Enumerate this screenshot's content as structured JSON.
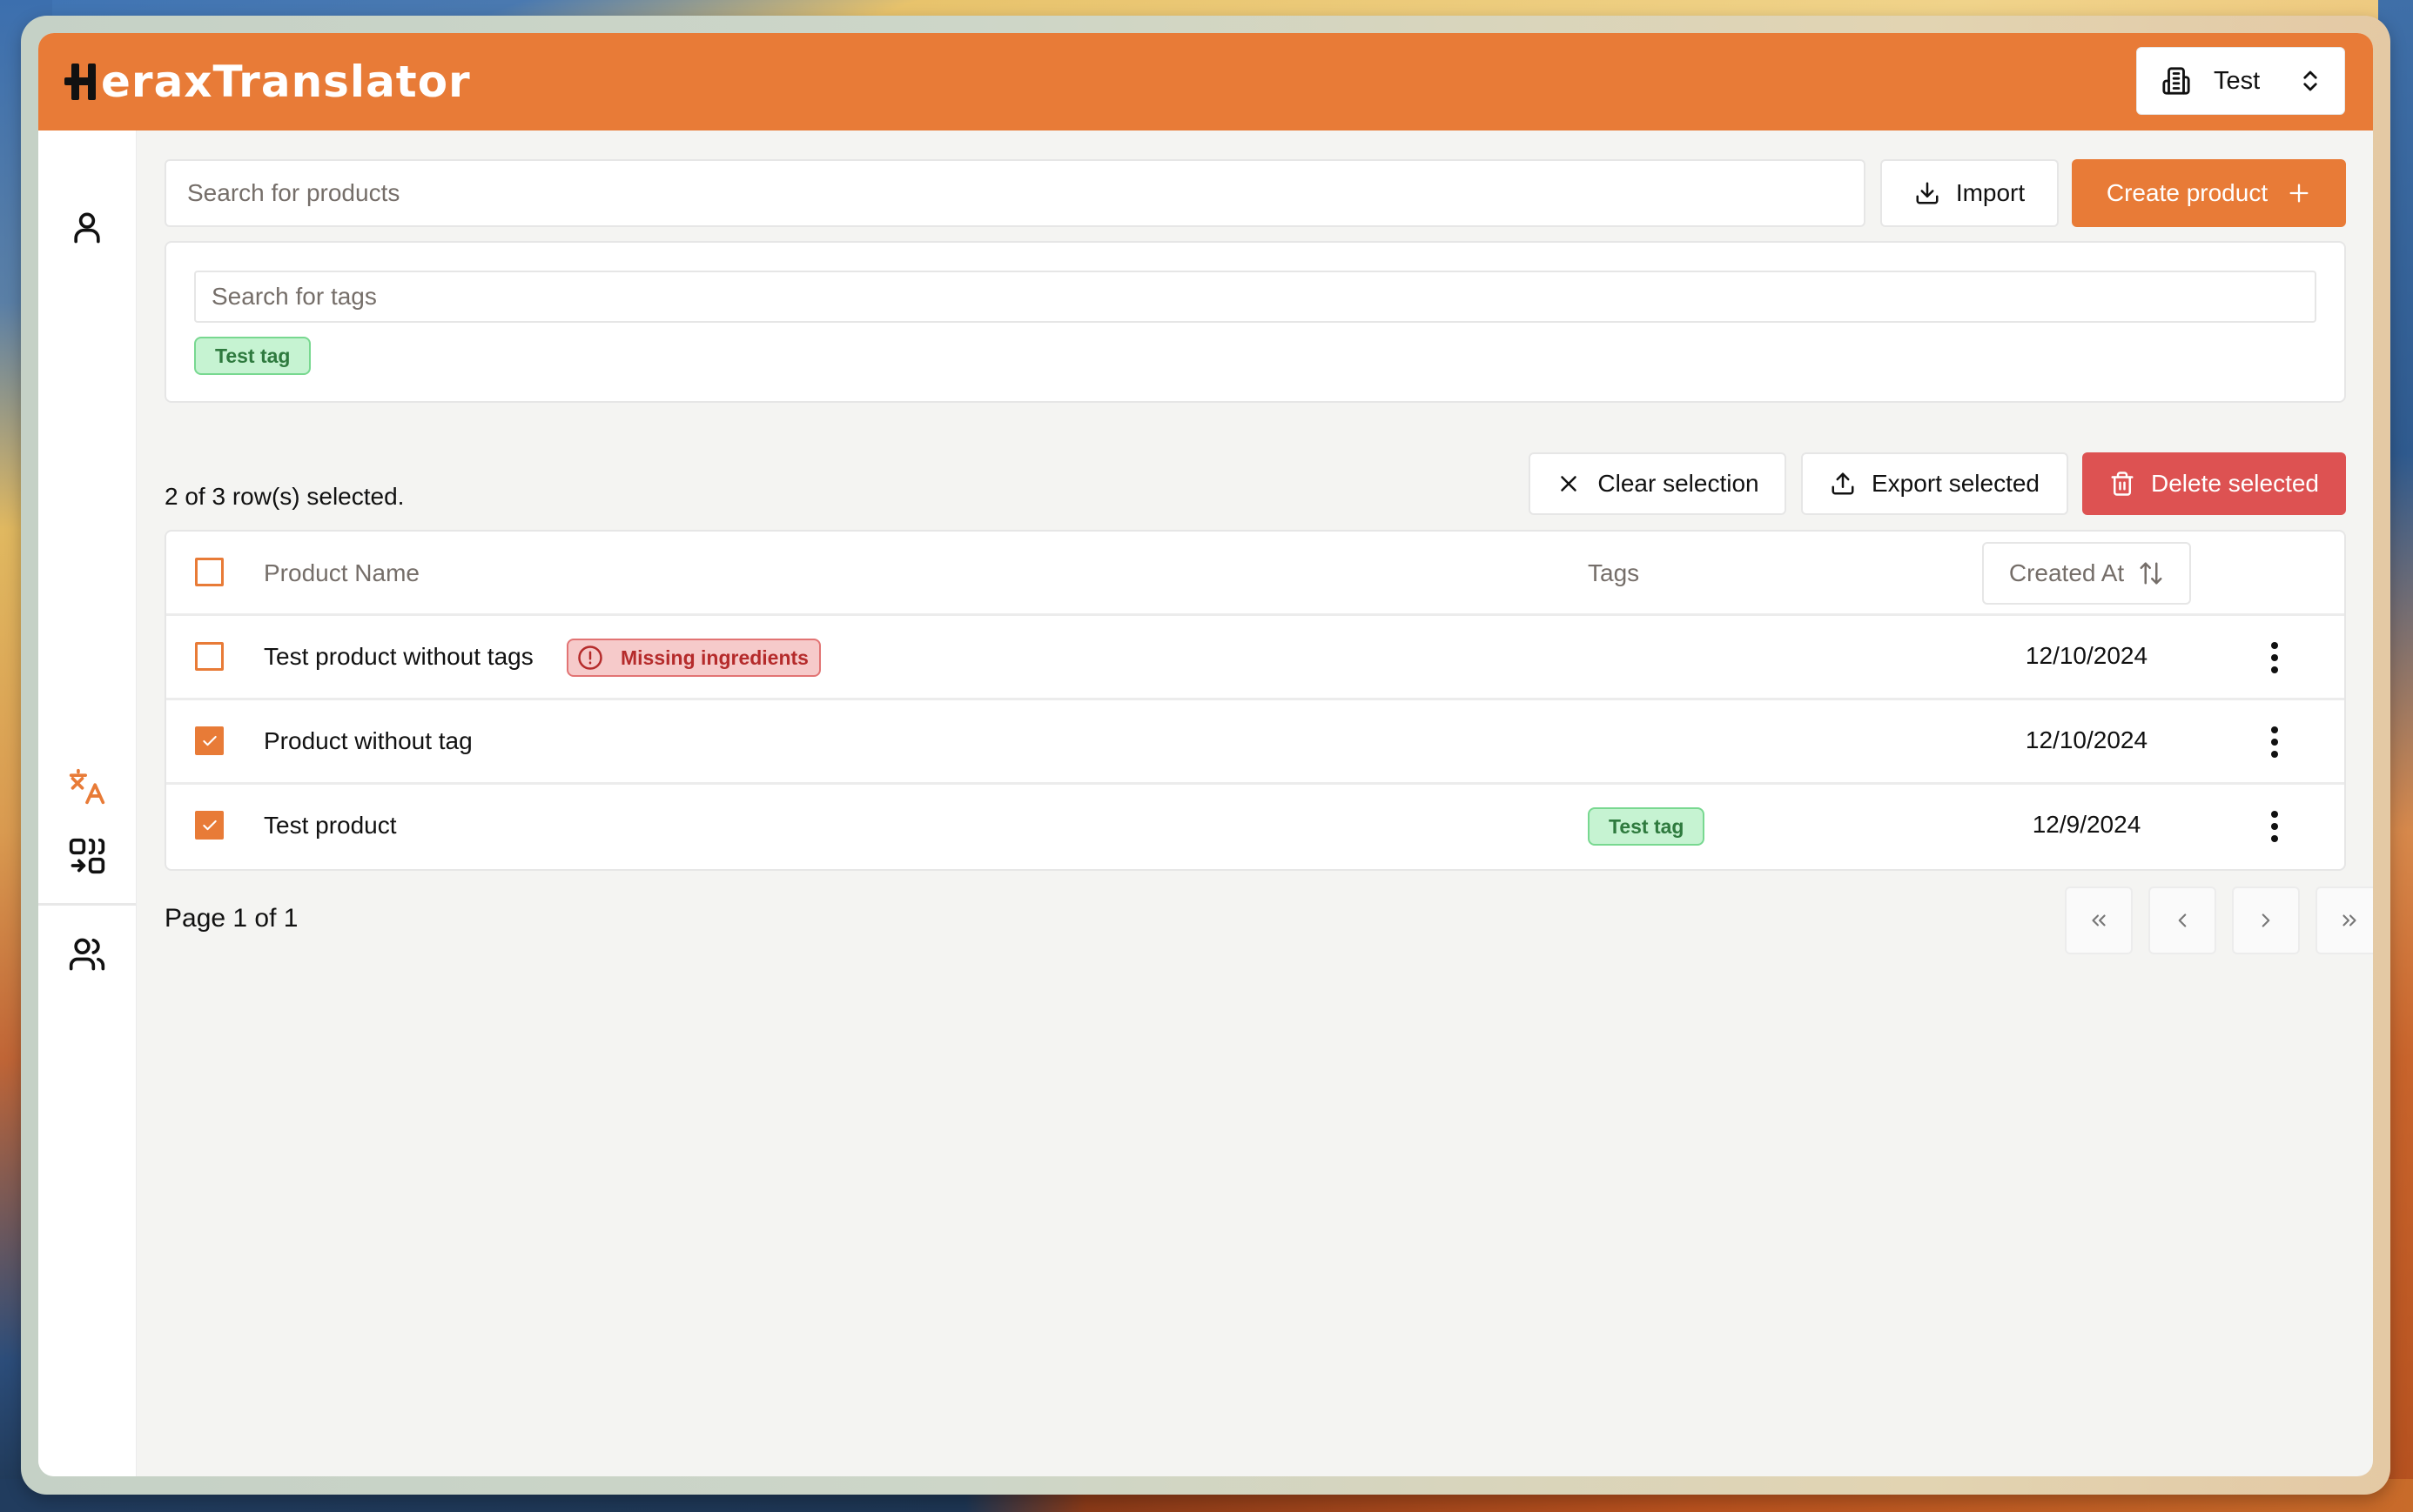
{
  "app": {
    "title_prefix": "H",
    "title_rest": "eraxTranslator",
    "accent_color": "#e87b37",
    "danger_color": "#dd5252"
  },
  "org_switcher": {
    "icon": "building-icon",
    "label": "Test",
    "chevron_icon": "chevrons-up-down-icon"
  },
  "sidebar": {
    "items": [
      {
        "name": "profile",
        "icon": "user-icon",
        "active": false
      },
      {
        "name": "translations",
        "icon": "languages-icon",
        "active": true
      },
      {
        "name": "products",
        "icon": "replace-icon",
        "active": false
      },
      {
        "name": "users",
        "icon": "users-icon",
        "active": false
      }
    ]
  },
  "toolbar": {
    "search_placeholder": "Search for products",
    "search_value": "",
    "import_label": "Import",
    "create_label": "Create product"
  },
  "tag_filter": {
    "placeholder": "Search for tags",
    "value": "",
    "tags": [
      "Test tag"
    ]
  },
  "selection": {
    "summary": "2 of 3 row(s) selected.",
    "clear_label": "Clear selection",
    "export_label": "Export selected",
    "delete_label": "Delete selected"
  },
  "table": {
    "columns": {
      "name": "Product Name",
      "tags": "Tags",
      "created_at": "Created At"
    },
    "header_checked": false,
    "rows": [
      {
        "name": "Test product without tags",
        "warning": "Missing ingredients",
        "tags": [],
        "created_at": "12/10/2024",
        "checked": false
      },
      {
        "name": "Product without tag",
        "warning": null,
        "tags": [],
        "created_at": "12/10/2024",
        "checked": true
      },
      {
        "name": "Test product",
        "warning": null,
        "tags": [
          "Test tag"
        ],
        "created_at": "12/9/2024",
        "checked": true
      }
    ]
  },
  "pagination": {
    "label": "Page 1 of 1",
    "current_page": 1,
    "total_pages": 1,
    "buttons": [
      "first-page",
      "previous-page",
      "next-page",
      "last-page"
    ]
  }
}
